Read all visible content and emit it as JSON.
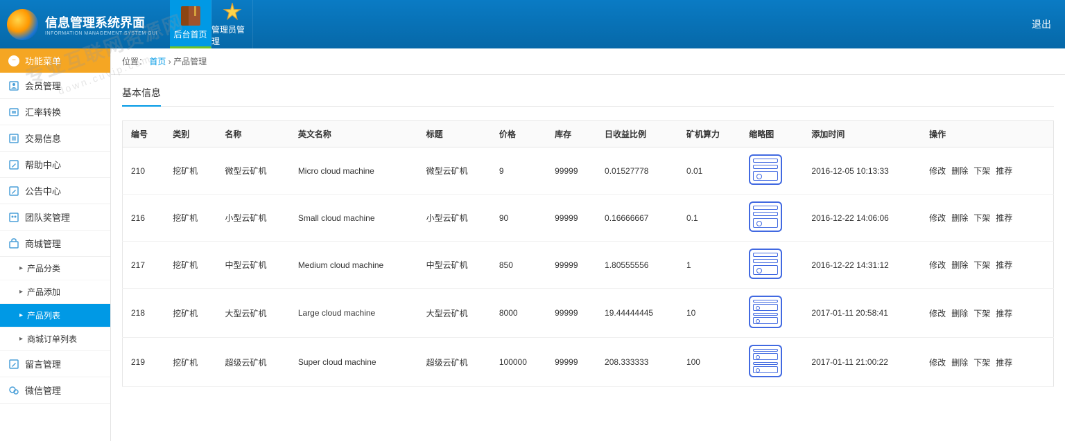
{
  "header": {
    "title": "信息管理系统界面",
    "subtitle": "INFORMATION MANAGEMENT SYSTEM GUI",
    "logout": "退出"
  },
  "topNav": [
    {
      "label": "后台首页",
      "active": true
    },
    {
      "label": "管理员管理",
      "active": false
    }
  ],
  "sidebar": {
    "header": "功能菜单",
    "items": [
      {
        "label": "会员管理",
        "icon": "user"
      },
      {
        "label": "汇率转换",
        "icon": "exchange"
      },
      {
        "label": "交易信息",
        "icon": "list"
      },
      {
        "label": "帮助中心",
        "icon": "edit"
      },
      {
        "label": "公告中心",
        "icon": "edit"
      },
      {
        "label": "团队奖管理",
        "icon": "group"
      },
      {
        "label": "商城管理",
        "icon": "shop",
        "expanded": true,
        "children": [
          {
            "label": "产品分类"
          },
          {
            "label": "产品添加"
          },
          {
            "label": "产品列表",
            "active": true
          },
          {
            "label": "商城订单列表"
          }
        ]
      },
      {
        "label": "留言管理",
        "icon": "edit"
      },
      {
        "label": "微信管理",
        "icon": "wechat"
      }
    ]
  },
  "breadcrumb": {
    "prefix": "位置：",
    "parts": [
      "首页",
      "产品管理"
    ],
    "sep": " › "
  },
  "panel": {
    "title": "基本信息"
  },
  "table": {
    "columns": [
      "编号",
      "类别",
      "名称",
      "英文名称",
      "标题",
      "价格",
      "库存",
      "日收益比例",
      "矿机算力",
      "缩略图",
      "添加时间",
      "操作"
    ],
    "actions": [
      "修改",
      "删除",
      "下架",
      "推荐"
    ],
    "rows": [
      {
        "id": "210",
        "cat": "挖矿机",
        "name": "微型云矿机",
        "en": "Micro cloud machine",
        "title": "微型云矿机",
        "price": "9",
        "stock": "99999",
        "ratio": "0.01527778",
        "power": "0.01",
        "thumb": "single",
        "time": "2016-12-05 10:13:33"
      },
      {
        "id": "216",
        "cat": "挖矿机",
        "name": "小型云矿机",
        "en": "Small cloud machine",
        "title": "小型云矿机",
        "price": "90",
        "stock": "99999",
        "ratio": "0.16666667",
        "power": "0.1",
        "thumb": "single",
        "time": "2016-12-22 14:06:06"
      },
      {
        "id": "217",
        "cat": "挖矿机",
        "name": "中型云矿机",
        "en": "Medium cloud machine",
        "title": "中型云矿机",
        "price": "850",
        "stock": "99999",
        "ratio": "1.80555556",
        "power": "1",
        "thumb": "single",
        "time": "2016-12-22 14:31:12"
      },
      {
        "id": "218",
        "cat": "挖矿机",
        "name": "大型云矿机",
        "en": "Large cloud machine",
        "title": "大型云矿机",
        "price": "8000",
        "stock": "99999",
        "ratio": "19.44444445",
        "power": "10",
        "thumb": "multi",
        "time": "2017-01-11 20:58:41"
      },
      {
        "id": "219",
        "cat": "挖矿机",
        "name": "超级云矿机",
        "en": "Super cloud machine",
        "title": "超级云矿机",
        "price": "100000",
        "stock": "99999",
        "ratio": "208.333333",
        "power": "100",
        "thumb": "multi",
        "time": "2017-01-11 21:00:22"
      }
    ]
  },
  "watermark": {
    "line1": "专业互联网资源网",
    "line2": "down.cuvip.com"
  }
}
